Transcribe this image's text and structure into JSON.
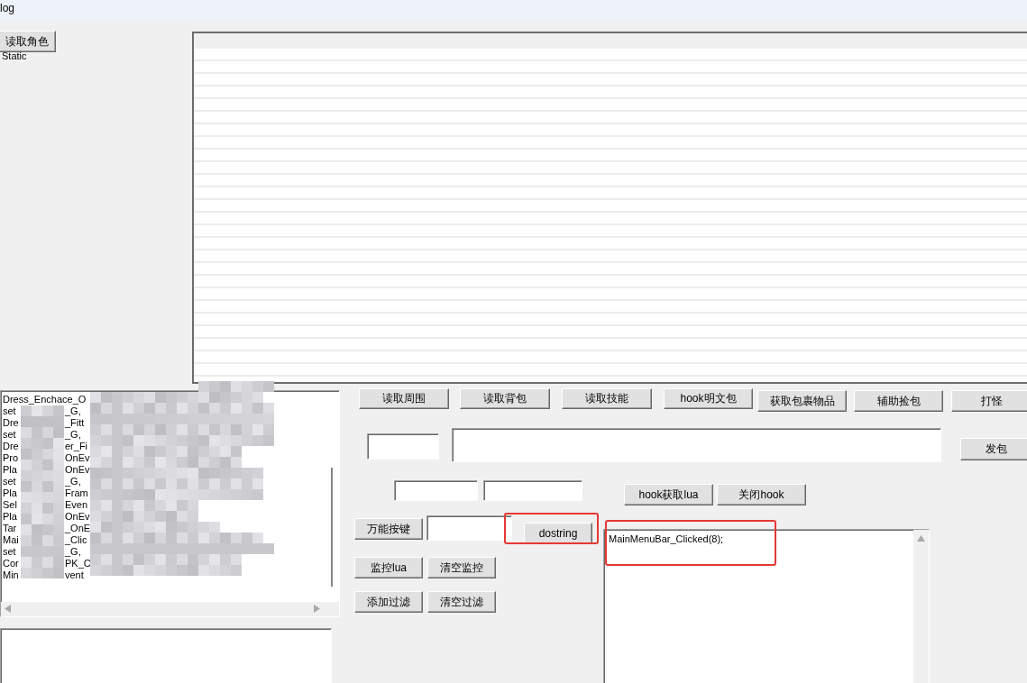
{
  "window": {
    "title": "log"
  },
  "read_role_button": "读取角色",
  "static_label": "Static",
  "log_list": {
    "rows": [
      {
        "prefix": "Dress_Enchace_O",
        "suffix": ""
      },
      {
        "prefix": "set",
        "suffix": "_G,"
      },
      {
        "prefix": "Dre",
        "suffix": "_Fitt"
      },
      {
        "prefix": "set",
        "suffix": "_G,"
      },
      {
        "prefix": "Dre",
        "suffix": "er_Fi"
      },
      {
        "prefix": "Pro",
        "suffix": "OnEv"
      },
      {
        "prefix": "Pla",
        "suffix": "OnEv"
      },
      {
        "prefix": "set",
        "suffix": "_G,"
      },
      {
        "prefix": "Pla",
        "suffix": "Fram"
      },
      {
        "prefix": "Sel",
        "suffix": "Even"
      },
      {
        "prefix": "Pla",
        "suffix": "OnEv"
      },
      {
        "prefix": "Tar",
        "suffix": "_OnE"
      },
      {
        "prefix": "Mai",
        "suffix": "_Clic"
      },
      {
        "prefix": "set",
        "suffix": "_G,"
      },
      {
        "prefix": "Cor",
        "suffix": "PK_C"
      },
      {
        "prefix": "Min",
        "suffix": "vent"
      }
    ]
  },
  "top_buttons": [
    "读取周围",
    "读取背包",
    "读取技能",
    "hook明文包",
    "获取包裹物品",
    "辅助捡包",
    "打怪"
  ],
  "send_button": "发包",
  "hook_buttons": [
    "hook获取lua",
    "关闭hook"
  ],
  "hotkey_button": "万能按键",
  "dostring_button": "dostring",
  "monitor_buttons": [
    "监控lua",
    "清空监控"
  ],
  "filter_buttons": [
    "添加过滤",
    "清空过滤"
  ],
  "lua_output": {
    "text": "MainMenuBar_Clicked(8);"
  },
  "annotations": [
    {
      "kind": "box"
    },
    {
      "kind": "box"
    }
  ]
}
